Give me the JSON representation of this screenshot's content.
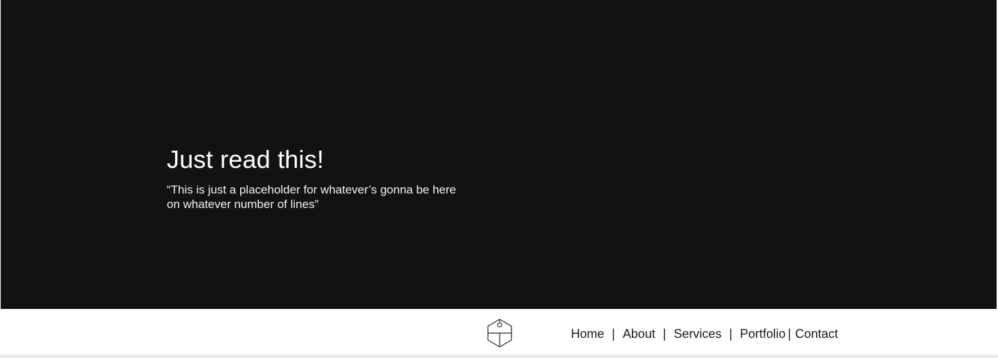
{
  "hero": {
    "title": "Just read this!",
    "quote_line1": "“This is just a placeholder for whatever’s gonna be here",
    "quote_line2": "on whatever number of lines”"
  },
  "footer": {
    "logo_icon": "cube-logo-icon",
    "nav": {
      "items": [
        {
          "label": "Home"
        },
        {
          "label": "About"
        },
        {
          "label": "Services"
        },
        {
          "label": "Portfolio"
        },
        {
          "label": "Contact"
        }
      ],
      "separator": "|"
    }
  },
  "colors": {
    "hero_background": "#121212",
    "hero_text": "#ffffff",
    "footer_background": "#ffffff",
    "nav_text": "#1a1a1a",
    "footer_strip": "#ebebeb"
  }
}
